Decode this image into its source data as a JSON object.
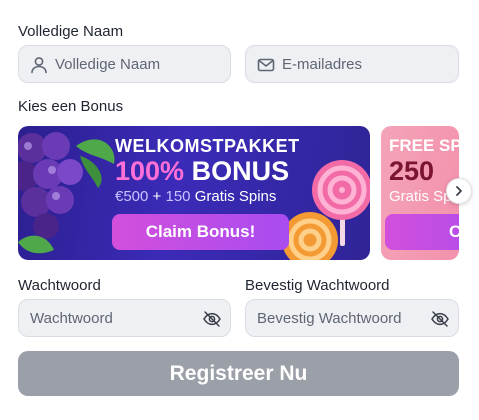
{
  "form": {
    "full_name_label": "Volledige Naam",
    "full_name_placeholder": "Volledige Naam",
    "email_placeholder": "E-mailadres",
    "bonus_label": "Kies een Bonus",
    "password_label": "Wachtwoord",
    "password_placeholder": "Wachtwoord",
    "confirm_label": "Bevestig Wachtwoord",
    "confirm_placeholder": "Bevestig Wachtwoord",
    "submit_label": "Registreer Nu"
  },
  "bonuses": [
    {
      "title": "WELKOMSTPAKKET",
      "headline_pct": "100%",
      "headline_word": "BONUS",
      "amount": "€500",
      "plus": "+",
      "spins": "150",
      "spins_text": "Gratis Spins",
      "cta": "Claim Bonus!"
    },
    {
      "title": "FREE SP",
      "headline": "250",
      "subtext": "Gratis Sp",
      "cta": "C"
    }
  ],
  "icons": {
    "name": "user-icon",
    "email": "mail-icon",
    "password_toggle": "eye-off-icon",
    "next": "chevron-right-icon"
  },
  "colors": {
    "field_bg": "#eef0f3",
    "banner_primary": "#3b2bb8",
    "banner_secondary": "#f28aa6",
    "cta_gradient_start": "#d34fdc",
    "cta_gradient_end": "#a84cf0",
    "submit_disabled": "#9a9fa8"
  }
}
